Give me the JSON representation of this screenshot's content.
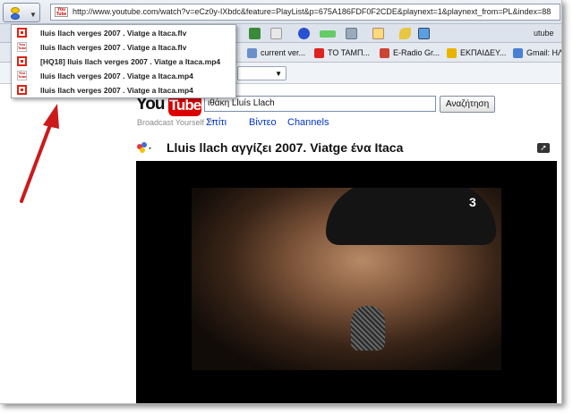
{
  "address_bar": {
    "url": "http://www.youtube.com/watch?v=eCz0y-IXbdc&feature=PlayList&p=675A186FDF0F2CDE&playnext=1&playnext_from=PL&index=88"
  },
  "toolbar": {
    "utube_label": "utube"
  },
  "bookmarks": [
    {
      "label": "current ver..."
    },
    {
      "label": "ΤΟ ΤΑΜΠ..."
    },
    {
      "label": "E-Radio Gr..."
    },
    {
      "label": "ΕΚΠΑΙΔΕΥ..."
    },
    {
      "label": "Gmail: ΗΛ"
    }
  ],
  "dropdown": {
    "items": [
      {
        "label": "lluis llach verges 2007 . Viatge a Itaca.flv",
        "icon": "red-icon"
      },
      {
        "label": "lluis llach verges 2007 . Viatge a Itaca.flv",
        "icon": "youtube-icon"
      },
      {
        "label": "[HQ18] lluis llach verges 2007 . Viatge a Itaca.mp4",
        "icon": "red-icon"
      },
      {
        "label": "lluis llach verges 2007 . Viatge a Itaca.mp4",
        "icon": "youtube-icon"
      },
      {
        "label": "lluis llach verges 2007 . Viatge a Itaca.mp4",
        "icon": "red-icon"
      }
    ]
  },
  "youtube": {
    "logo_you": "You",
    "logo_tube": "Tube",
    "tagline": "Broadcast Yourself ™",
    "search_value": "ιθάκη Lluís Llach",
    "search_button": "Αναζήτηση",
    "nav": [
      "Σπίτι",
      "Βίντεο",
      "Channels"
    ],
    "video_title": "Lluis llach αγγίζει 2007. Viatge ένα Itaca",
    "channel_badge": "3"
  },
  "colors": {
    "accent_red": "#cc1111",
    "link_blue": "#0033cc",
    "arrow_red": "#cc1a1a"
  }
}
